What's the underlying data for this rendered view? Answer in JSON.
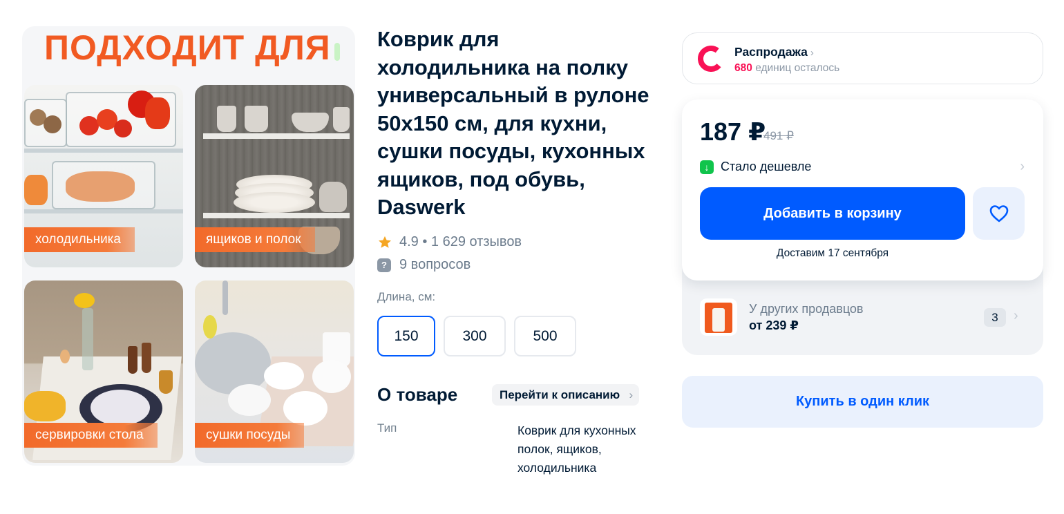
{
  "gallery": {
    "heading": "ПОДХОДИТ ДЛЯ",
    "tiles": [
      {
        "label": "холодильника"
      },
      {
        "label": "ящиков и полок"
      },
      {
        "label": "сервировки стола"
      },
      {
        "label": "сушки посуды"
      }
    ]
  },
  "product": {
    "title": "Коврик для холодильника на полку универсальный в рулоне 50х150 см, для кухни, сушки посуды, кухонных ящиков, под обувь, Daswerk",
    "rating_text": "4.9 • 1 629 отзывов",
    "questions_text": "9 вопросов",
    "length_label": "Длина, см:",
    "length_options": [
      "150",
      "300",
      "500"
    ],
    "selected_length": "150",
    "about_title": "О товаре",
    "description_link": "Перейти к описанию",
    "specs": [
      {
        "key": "Тип",
        "value": "Коврик для кухонных полок, ящиков, холодильника"
      }
    ]
  },
  "sale": {
    "title": "Распродажа",
    "count": "680",
    "remaining_text": "единиц осталось",
    "accent_color": "#f91155"
  },
  "buy": {
    "price": "187 ₽",
    "old_price": "491 ₽",
    "cheaper_text": "Стало дешевле",
    "add_to_cart": "Добавить в корзину",
    "delivery": "Доставим 17 сентября",
    "accent_color": "#005bff"
  },
  "other_sellers": {
    "title": "У других продавцов",
    "price": "от 239 ₽",
    "count": "3"
  },
  "one_click": "Купить в один клик",
  "icons": {
    "favorite": "heart-icon",
    "rating": "star-icon",
    "questions": "question-bubble-icon",
    "cheaper": "arrow-down-icon",
    "sale": "sale-ring-icon"
  }
}
